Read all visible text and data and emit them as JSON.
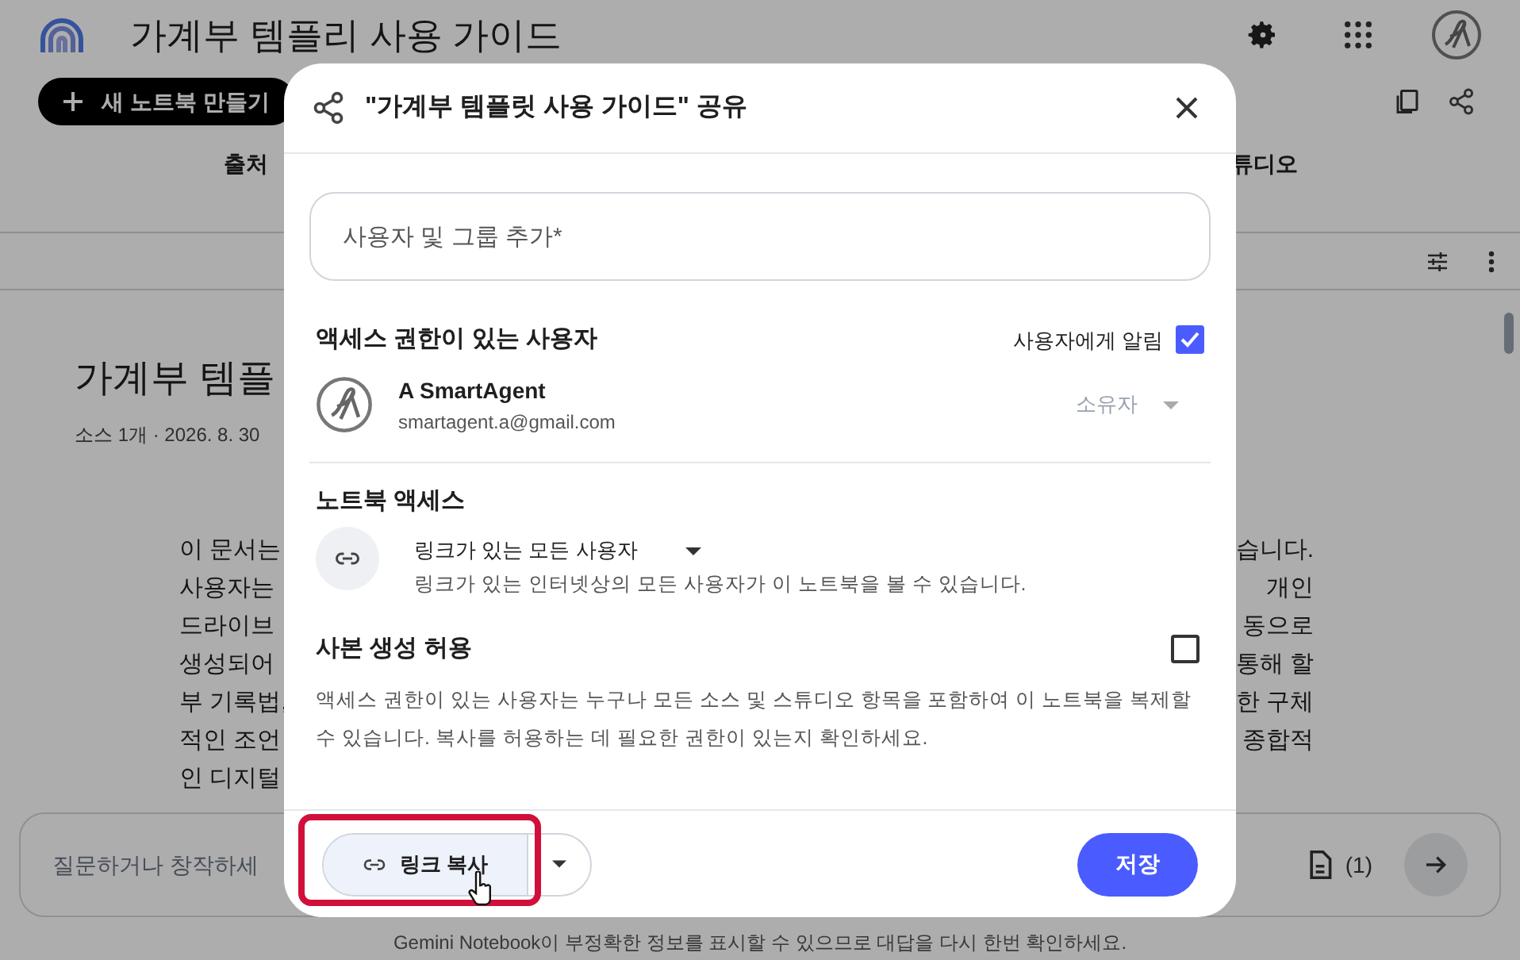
{
  "app": {
    "title": "가계부 템플리 사용 가이드",
    "new_notebook_button": "새 노트북 만들기",
    "tabs": [
      {
        "label": "출처"
      },
      {
        "label": "튜디오"
      }
    ],
    "document": {
      "title": "가계부 템플",
      "meta": "소스 1개 · 2026. 8. 30",
      "lines_left": [
        "이 문서는",
        "사용자는",
        "드라이브",
        "생성되어",
        "부 기록법,",
        "적인 조언",
        "인 디지털"
      ],
      "lines_right": [
        "습니다.",
        "개인",
        "동으로",
        "통해 할",
        "한 구체",
        "종합적"
      ]
    },
    "chat": {
      "placeholder": "질문하거나 창작하세",
      "source_count": "(1)"
    },
    "footer": "Gemini Notebook이 부정확한 정보를 표시할 수 있으므로 대답을 다시 한번 확인하세요."
  },
  "dialog": {
    "title": "\"가계부 템플릿 사용 가이드\" 공유",
    "add_people_placeholder": "사용자 및 그룹 추가*",
    "people_section": {
      "heading": "액세스 권한이 있는 사용자",
      "notify_label": "사용자에게 알림",
      "notify_checked": true,
      "people": [
        {
          "name": "A SmartAgent",
          "email": "smartagent.a@gmail.com",
          "role": "소유자",
          "role_disabled": true
        }
      ]
    },
    "access_section": {
      "heading": "노트북 액세스",
      "option": "링크가 있는 모든 사용자",
      "description": "링크가 있는 인터넷상의 모든 사용자가 이 노트북을 볼 수 있습니다."
    },
    "copy_section": {
      "heading": "사본 생성 허용",
      "checked": false,
      "description": "액세스 권한이 있는 사용자는 누구나 모든 소스 및 스튜디오 항목을 포함하여 이 노트북을 복제할 수 있습니다. 복사를 허용하는 데 필요한 권한이 있는지 확인하세요."
    },
    "copy_link_button": "링크 복사",
    "copy_link_highlighted": true,
    "save_button": "저장"
  }
}
